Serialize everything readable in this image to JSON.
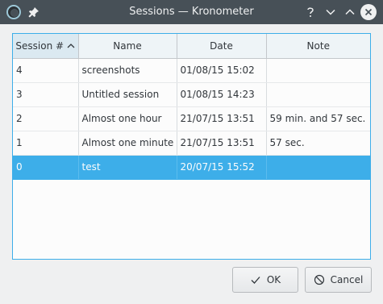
{
  "window": {
    "title": "Sessions — Kronometer",
    "icons": [
      "kronometer-app-icon",
      "pin-icon",
      "help-icon",
      "minimize-icon",
      "maximize-icon",
      "close-icon"
    ]
  },
  "table": {
    "columns": [
      "Session #",
      "Name",
      "Date",
      "Note"
    ],
    "sorted_column": "Session #",
    "sort_order": "ascending",
    "rows": [
      [
        "4",
        "screenshots",
        "01/08/15 15:02",
        ""
      ],
      [
        "3",
        "Untitled session",
        "01/08/15 14:23",
        ""
      ],
      [
        "2",
        "Almost one hour",
        "21/07/15 13:51",
        "59 min. and 57 sec."
      ],
      [
        "1",
        "Almost one minute",
        "21/07/15 13:51",
        "57 sec."
      ],
      [
        "0",
        "test",
        "20/07/15 15:52",
        ""
      ]
    ],
    "selected_row": "0"
  },
  "buttons": {
    "ok": "OK",
    "cancel": "Cancel"
  },
  "colors": {
    "titlebar": "#475057",
    "selection": "#3daee9",
    "window_bg": "#eff0f1"
  }
}
